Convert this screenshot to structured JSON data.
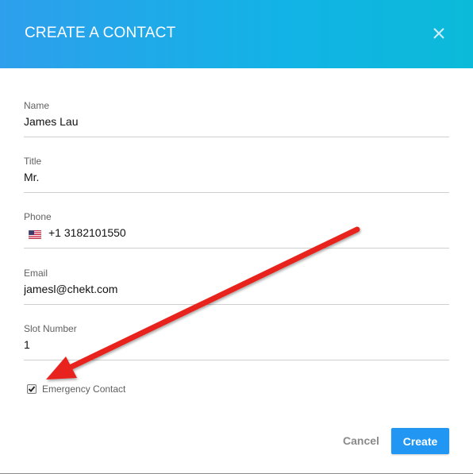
{
  "dialog": {
    "title": "CREATE A CONTACT",
    "close_icon": "close-icon"
  },
  "fields": {
    "name": {
      "label": "Name",
      "value": "James Lau"
    },
    "title": {
      "label": "Title",
      "value": "Mr."
    },
    "phone": {
      "label": "Phone",
      "value": "+1 3182101550",
      "flag_icon": "us-flag-icon"
    },
    "email": {
      "label": "Email",
      "value": "jamesl@chekt.com"
    },
    "slot": {
      "label": "Slot Number",
      "value": "1"
    }
  },
  "emergency": {
    "label": "Emergency Contact",
    "checked": true
  },
  "actions": {
    "cancel_label": "Cancel",
    "create_label": "Create"
  },
  "colors": {
    "header_gradient_start": "#2e9fec",
    "header_gradient_end": "#0bbad8",
    "primary_button": "#2196f3",
    "annotation_arrow": "#e8201a"
  }
}
